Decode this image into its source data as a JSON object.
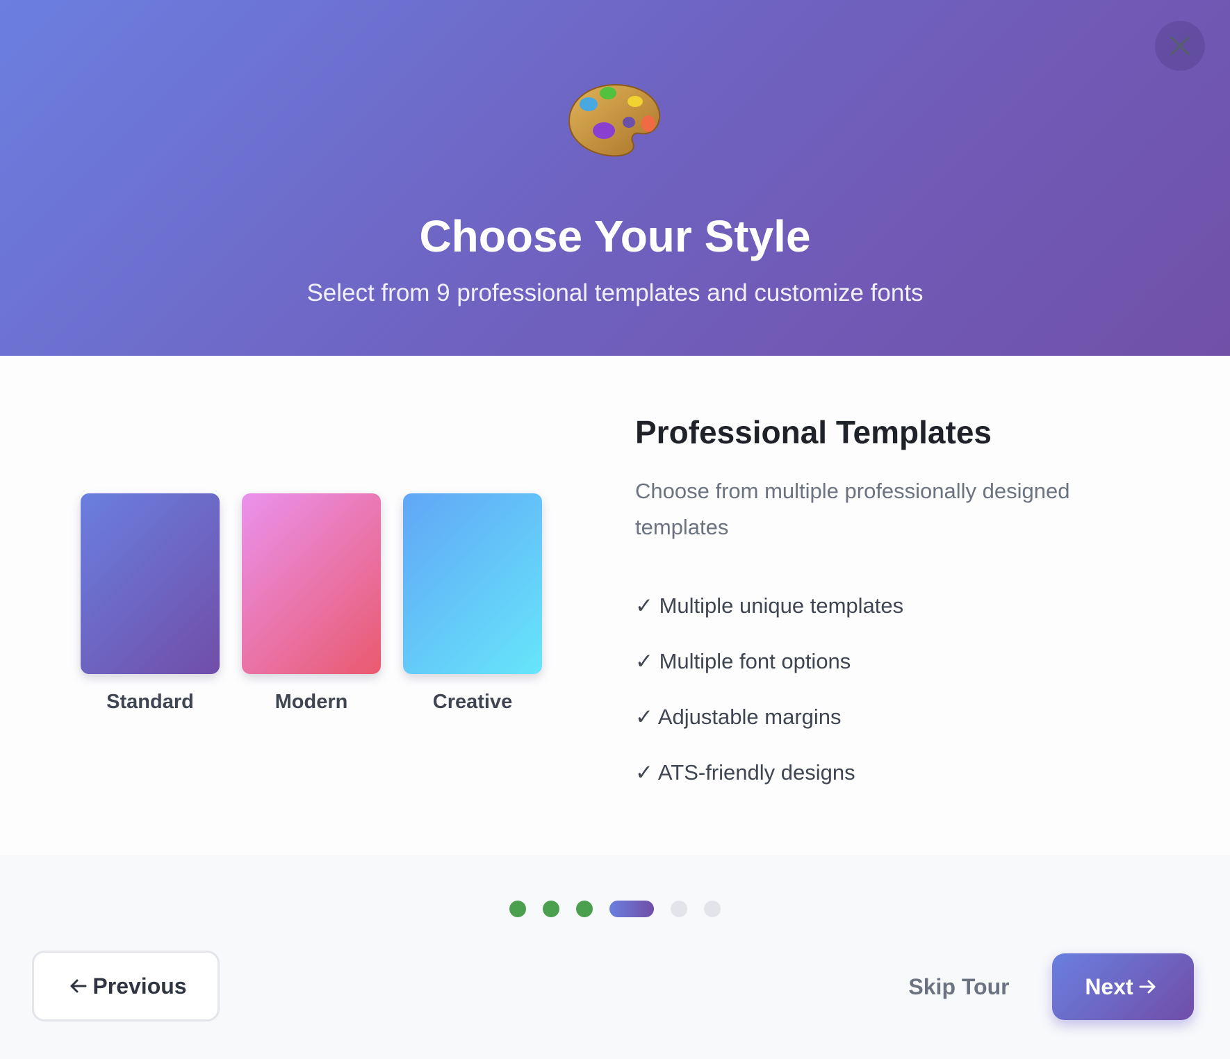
{
  "header": {
    "icon": "palette-icon",
    "title": "Choose Your Style",
    "subtitle": "Select from 9 professional templates and customize fonts",
    "close_icon": "close-icon"
  },
  "templates": [
    {
      "label": "Standard",
      "colors": [
        "#6a7fdf",
        "#704ea8"
      ]
    },
    {
      "label": "Modern",
      "colors": [
        "#ea92ee",
        "#e95a6e"
      ]
    },
    {
      "label": "Creative",
      "colors": [
        "#61a6f6",
        "#66e6fa"
      ]
    }
  ],
  "features": {
    "title": "Professional Templates",
    "description": "Choose from multiple professionally designed templates",
    "items": [
      "✓ Multiple unique templates",
      "✓ Multiple font options",
      "✓ Adjustable margins",
      "✓ ATS-friendly designs"
    ]
  },
  "progress": {
    "total_steps": 6,
    "current_step": 4,
    "completed_color": "#4aa04e",
    "upcoming_color": "#e2e4e9"
  },
  "footer": {
    "previous_label": "Previous",
    "skip_label": "Skip Tour",
    "next_label": "Next",
    "previous_icon": "arrow-left-icon",
    "next_icon": "arrow-right-icon"
  },
  "colors": {
    "accent_start": "#6a7fdf",
    "accent_end": "#704ea8"
  }
}
